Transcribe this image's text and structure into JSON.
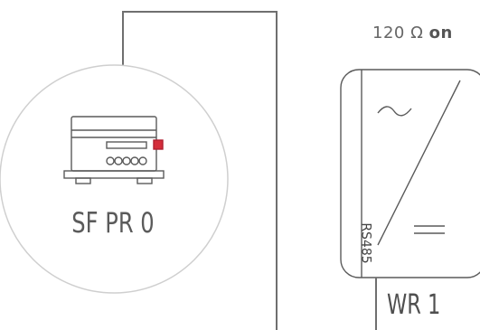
{
  "termination": {
    "prefix": "120 Ω",
    "state": "on"
  },
  "device": {
    "name": "SF PR 0",
    "icon": "modular-controller-icon"
  },
  "inverter": {
    "name": "WR 1",
    "port": "RS485",
    "icon": "inverter-ac-dc-icon"
  },
  "colors": {
    "line": "#6f6f6f",
    "circle": "#cfcfcf",
    "accent": "#d42d3a"
  }
}
